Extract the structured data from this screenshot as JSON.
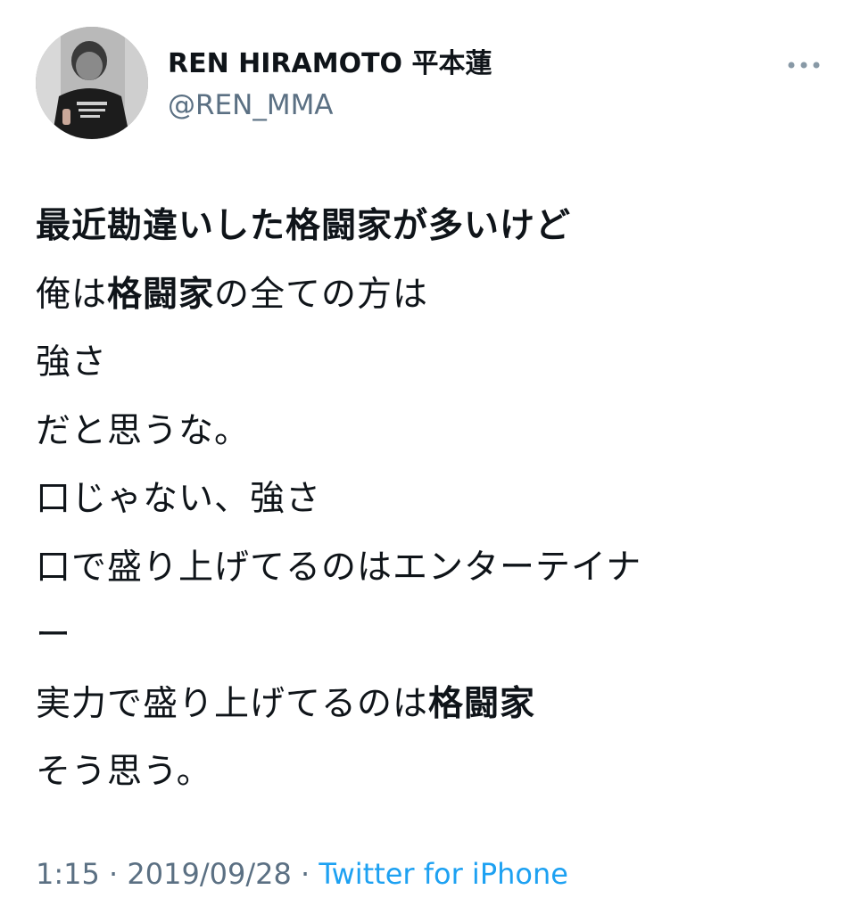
{
  "author": {
    "display_name": "REN HIRAMOTO 平本蓮",
    "handle": "@REN_MMA",
    "avatar_icon": "profile-photo"
  },
  "more_icon": "more-horizontal-icon",
  "tweet": {
    "lines": [
      {
        "segments": [
          {
            "text": "最近勘違いした格闘家が多いけど",
            "bold": true
          }
        ]
      },
      {
        "segments": [
          {
            "text": "俺は",
            "bold": false
          },
          {
            "text": "格闘家",
            "bold": true
          },
          {
            "text": "の全ての方は",
            "bold": false
          }
        ]
      },
      {
        "segments": [
          {
            "text": "強さ",
            "bold": false
          }
        ]
      },
      {
        "segments": [
          {
            "text": "だと思うな。",
            "bold": false
          }
        ]
      },
      {
        "segments": [
          {
            "text": "口じゃない、強さ",
            "bold": false
          }
        ]
      },
      {
        "segments": [
          {
            "text": "口で盛り上げてるのはエンターテイナ",
            "bold": false
          }
        ]
      },
      {
        "segments": [
          {
            "text": "ー",
            "bold": false
          }
        ]
      },
      {
        "segments": [
          {
            "text": "実力で盛り上げてるのは",
            "bold": false
          },
          {
            "text": "格闘家",
            "bold": true
          }
        ]
      },
      {
        "segments": [
          {
            "text": "そう思う。",
            "bold": false
          }
        ]
      }
    ]
  },
  "meta": {
    "time": "1:15",
    "separator": " · ",
    "date": "2019/09/28",
    "source": "Twitter for iPhone"
  },
  "colors": {
    "text": "#0f1419",
    "secondary": "#5b7083",
    "link": "#1da1f2",
    "background": "#ffffff"
  }
}
